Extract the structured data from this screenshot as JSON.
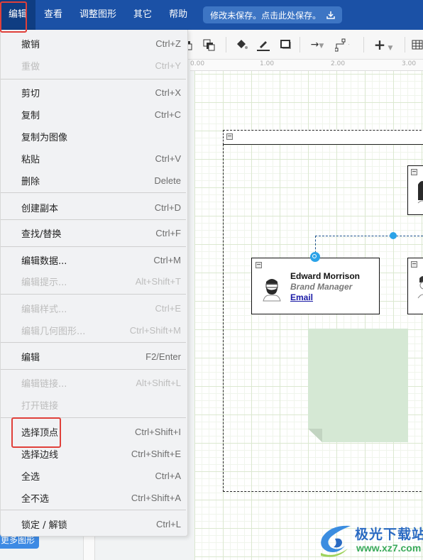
{
  "menubar": {
    "items": [
      {
        "label": "编辑",
        "active": true
      },
      {
        "label": "查看"
      },
      {
        "label": "调整图形"
      },
      {
        "label": "其它"
      },
      {
        "label": "帮助"
      }
    ],
    "save_notice": "修改未保存。点击此处保存。"
  },
  "ruler": {
    "ticks": [
      "0.00",
      "1.00",
      "2.00",
      "3.00"
    ]
  },
  "left_panel": {
    "more_shapes_label": "更多图形"
  },
  "edit_menu": {
    "items": [
      {
        "label": "撤销",
        "shortcut": "Ctrl+Z",
        "enabled": true
      },
      {
        "label": "重做",
        "shortcut": "Ctrl+Y",
        "enabled": false
      },
      {
        "label": "剪切",
        "shortcut": "Ctrl+X",
        "enabled": true
      },
      {
        "label": "复制",
        "shortcut": "Ctrl+C",
        "enabled": true
      },
      {
        "label": "复制为图像",
        "shortcut": "",
        "enabled": true
      },
      {
        "label": "粘贴",
        "shortcut": "Ctrl+V",
        "enabled": true
      },
      {
        "label": "删除",
        "shortcut": "Delete",
        "enabled": true
      },
      {
        "label": "创建副本",
        "shortcut": "Ctrl+D",
        "enabled": true
      },
      {
        "label": "查找/替换",
        "shortcut": "Ctrl+F",
        "enabled": true
      },
      {
        "label": "编辑数据...",
        "shortcut": "Ctrl+M",
        "enabled": true
      },
      {
        "label": "编辑提示...",
        "shortcut": "Alt+Shift+T",
        "enabled": false
      },
      {
        "label": "编辑样式...",
        "shortcut": "Ctrl+E",
        "enabled": false
      },
      {
        "label": "编辑几何图形...",
        "shortcut": "Ctrl+Shift+M",
        "enabled": false
      },
      {
        "label": "编辑",
        "shortcut": "F2/Enter",
        "enabled": true
      },
      {
        "label": "编辑链接...",
        "shortcut": "Alt+Shift+L",
        "enabled": false
      },
      {
        "label": "打开链接",
        "shortcut": "",
        "enabled": false
      },
      {
        "label": "选择顶点",
        "shortcut": "Ctrl+Shift+I",
        "enabled": true,
        "highlighted": true
      },
      {
        "label": "选择边线",
        "shortcut": "Ctrl+Shift+E",
        "enabled": true
      },
      {
        "label": "全选",
        "shortcut": "Ctrl+A",
        "enabled": true
      },
      {
        "label": "全不选",
        "shortcut": "Ctrl+Shift+A",
        "enabled": true
      },
      {
        "label": "锁定 / 解锁",
        "shortcut": "Ctrl+L",
        "enabled": true
      }
    ]
  },
  "diagram": {
    "card": {
      "name": "Edward Morrison",
      "role": "Brand Manager",
      "link": "Email"
    },
    "collapse_symbol": "−"
  },
  "watermark": {
    "title": "极光下载站",
    "url": "www.xz7.com"
  },
  "colors": {
    "menubar": "#1b51a6",
    "highlight": "#e0403a",
    "handle": "#2ba3e8",
    "note": "#d5e8d4"
  }
}
